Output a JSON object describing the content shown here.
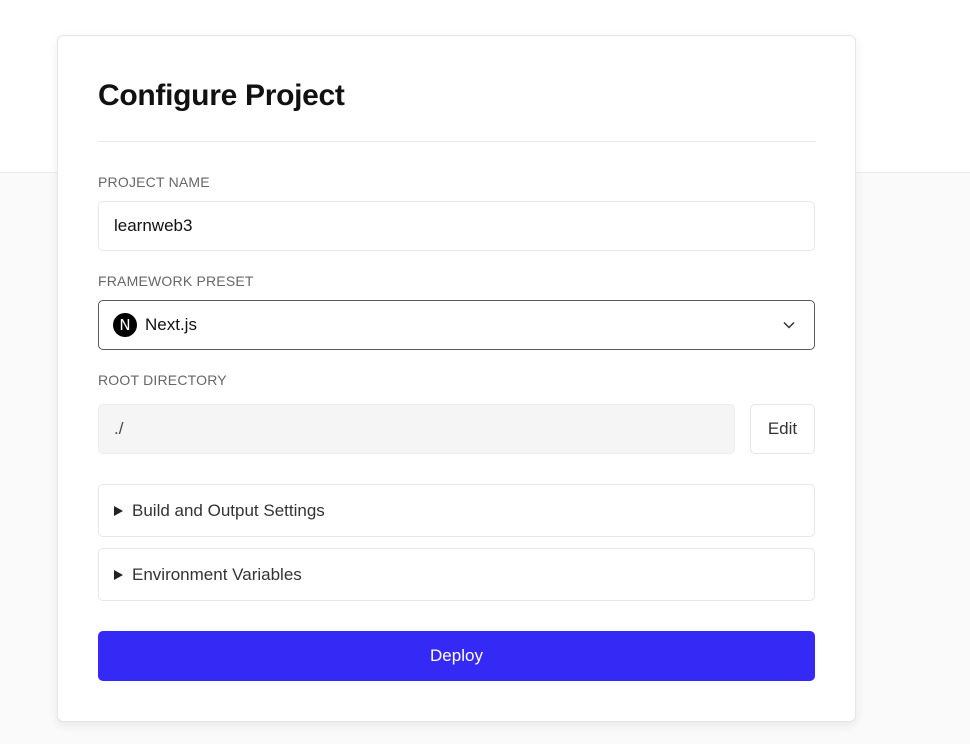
{
  "card": {
    "title": "Configure Project"
  },
  "project_name": {
    "label": "PROJECT NAME",
    "value": "learnweb3"
  },
  "framework_preset": {
    "label": "FRAMEWORK PRESET",
    "icon": "nextjs-logo-icon",
    "icon_glyph": "N",
    "value": "Next.js"
  },
  "root_directory": {
    "label": "ROOT DIRECTORY",
    "value": "./",
    "edit_label": "Edit"
  },
  "sections": [
    {
      "label": "Build and Output Settings"
    },
    {
      "label": "Environment Variables"
    }
  ],
  "deploy": {
    "label": "Deploy",
    "color": "#3429f5"
  }
}
